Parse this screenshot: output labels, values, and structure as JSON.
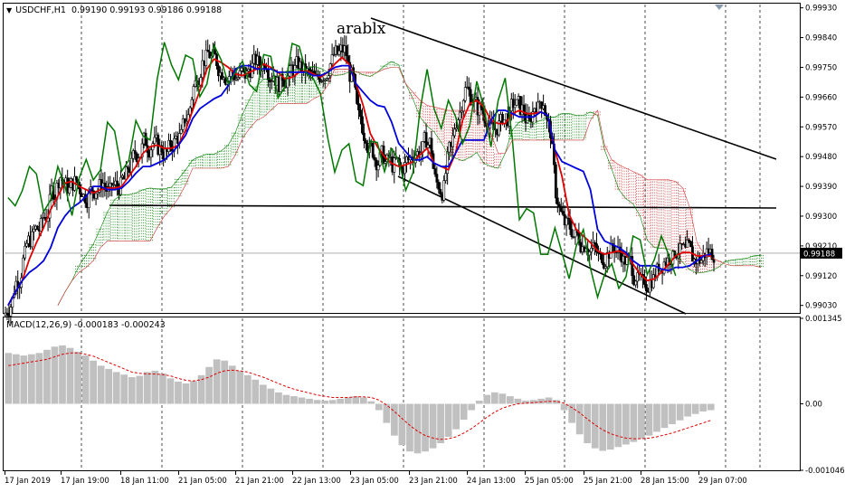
{
  "header": {
    "symbol": "USDCHF,H1",
    "ohlc": "0.99190 0.99193 0.99186 0.99188"
  },
  "watermark": "arablx",
  "macd_header": "MACD(12,26,9) -0.000183 -0.000243",
  "colors": {
    "candles": "#000000",
    "tenkan": "#e00000",
    "kijun": "#0000dd",
    "chikou": "#007700",
    "cloud_bull": "#008000",
    "cloud_bear": "#d03030",
    "macd_hist": "#c0c0c0",
    "macd_signal": "#e00000",
    "bid_line": "#a0a0a0"
  },
  "price_labels": [
    "0.99930",
    "0.99840",
    "0.99750",
    "0.99660",
    "0.99570",
    "0.99480",
    "0.99390",
    "0.99300",
    "0.99210",
    "0.99120",
    "0.99030"
  ],
  "current_price": "0.99188",
  "macd_labels": [
    "0.001345",
    "0.00",
    "-0.001046"
  ],
  "time_labels": [
    "17 Jan 2019",
    "17 Jan 19:00",
    "18 Jan 11:00",
    "21 Jan 05:00",
    "21 Jan 21:00",
    "22 Jan 13:00",
    "23 Jan 05:00",
    "23 Jan 21:00",
    "24 Jan 13:00",
    "25 Jan 05:00",
    "25 Jan 21:00",
    "28 Jan 15:00",
    "29 Jan 07:00"
  ],
  "chart_data": [
    {
      "type": "candlestick",
      "title": "USDCHF,H1",
      "ylim": [
        0.9901,
        0.9994
      ],
      "close_series": [
        0.9903,
        0.9911,
        0.9918,
        0.9923,
        0.9926,
        0.993,
        0.9938,
        0.9942,
        0.9939,
        0.994,
        0.9938,
        0.9936,
        0.9938,
        0.994,
        0.9937,
        0.9939,
        0.9941,
        0.9945,
        0.9949,
        0.9953,
        0.9952,
        0.995,
        0.9949,
        0.9952,
        0.9954,
        0.996,
        0.997,
        0.9976,
        0.9979,
        0.9977,
        0.9974,
        0.9973,
        0.9972,
        0.9973,
        0.9975,
        0.9976,
        0.9977,
        0.9973,
        0.997,
        0.9972,
        0.9974,
        0.9975,
        0.9973,
        0.9971,
        0.9973,
        0.9976,
        0.9979,
        0.998,
        0.9972,
        0.996,
        0.9955,
        0.995,
        0.9947,
        0.9946,
        0.9945,
        0.9944,
        0.9947,
        0.9949,
        0.995,
        0.9952,
        0.994,
        0.9938,
        0.995,
        0.996,
        0.9968,
        0.9966,
        0.9962,
        0.996,
        0.9956,
        0.9958,
        0.996,
        0.9964,
        0.9962,
        0.9958,
        0.9964,
        0.9965,
        0.9956,
        0.9935,
        0.9928,
        0.9926,
        0.9924,
        0.9922,
        0.992,
        0.9917,
        0.9918,
        0.9921,
        0.9919,
        0.9916,
        0.9912,
        0.9909,
        0.991,
        0.9913,
        0.9916,
        0.9918,
        0.992,
        0.9919,
        0.9918,
        0.9917,
        0.9919,
        0.99188
      ],
      "bid_line": 0.99188,
      "lines": [
        {
          "name": "Tenkan-sen",
          "color": "#e00000"
        },
        {
          "name": "Kijun-sen",
          "color": "#0000dd"
        },
        {
          "name": "Chikou Span",
          "color": "#007700"
        }
      ]
    },
    {
      "type": "bar",
      "title": "MACD(12,26,9)",
      "ylim": [
        -0.001046,
        0.001345
      ],
      "values": [
        0.0008,
        0.00078,
        0.00076,
        0.00078,
        0.0008,
        0.00085,
        0.0009,
        0.00092,
        0.00088,
        0.00082,
        0.00076,
        0.00068,
        0.0006,
        0.00055,
        0.0005,
        0.00046,
        0.00042,
        0.00044,
        0.0005,
        0.00052,
        0.00048,
        0.0004,
        0.00035,
        0.00032,
        0.00036,
        0.00045,
        0.00058,
        0.0007,
        0.00068,
        0.0006,
        0.00052,
        0.00045,
        0.00038,
        0.0003,
        0.00024,
        0.00018,
        0.00014,
        0.00012,
        0.0001,
        8e-05,
        6e-05,
        5e-05,
        6e-05,
        8e-05,
        0.0001,
        0.00012,
        0.0001,
        4e-05,
        -0.0001,
        -0.0003,
        -0.0005,
        -0.00065,
        -0.00075,
        -0.00078,
        -0.00075,
        -0.0007,
        -0.00062,
        -0.00052,
        -0.0004,
        -0.00025,
        -0.0001,
        5e-05,
        0.00014,
        0.00018,
        0.00016,
        0.00012,
        8e-05,
        5e-05,
        6e-05,
        8e-05,
        0.0001,
        6e-05,
        -0.0001,
        -0.0003,
        -0.00048,
        -0.00062,
        -0.0007,
        -0.00074,
        -0.00072,
        -0.00068,
        -0.00064,
        -0.0006,
        -0.00055,
        -0.0005,
        -0.00044,
        -0.00038,
        -0.00032,
        -0.00026,
        -0.0002,
        -0.00016,
        -0.00012,
        -0.0001
      ],
      "signal": [
        0.0006,
        0.00062,
        0.00064,
        0.00066,
        0.00068,
        0.0007,
        0.00074,
        0.00078,
        0.0008,
        0.0008,
        0.00078,
        0.00075,
        0.0007,
        0.00065,
        0.0006,
        0.00055,
        0.0005,
        0.00048,
        0.00047,
        0.00047,
        0.00046,
        0.00044,
        0.0004,
        0.00037,
        0.00036,
        0.00038,
        0.00042,
        0.00048,
        0.00052,
        0.00053,
        0.00052,
        0.0005,
        0.00046,
        0.00042,
        0.00037,
        0.00032,
        0.00027,
        0.00023,
        0.0002,
        0.00017,
        0.00014,
        0.00012,
        0.0001,
        0.0001,
        0.0001,
        0.00011,
        0.00011,
        0.0001,
        6e-05,
        -2e-05,
        -0.00012,
        -0.00023,
        -0.00034,
        -0.00043,
        -0.0005,
        -0.00054,
        -0.00056,
        -0.00055,
        -0.00052,
        -0.00046,
        -0.00039,
        -0.0003,
        -0.00021,
        -0.00013,
        -7e-05,
        -3e-05,
        0.0,
        1e-05,
        2e-05,
        3e-05,
        4e-05,
        4e-05,
        1e-05,
        -6e-05,
        -0.00014,
        -0.00024,
        -0.00033,
        -0.00041,
        -0.00047,
        -0.00051,
        -0.00054,
        -0.00055,
        -0.00055,
        -0.00054,
        -0.00052,
        -0.00049,
        -0.00046,
        -0.00042,
        -0.00038,
        -0.00034,
        -0.0003,
        -0.00026
      ]
    }
  ]
}
